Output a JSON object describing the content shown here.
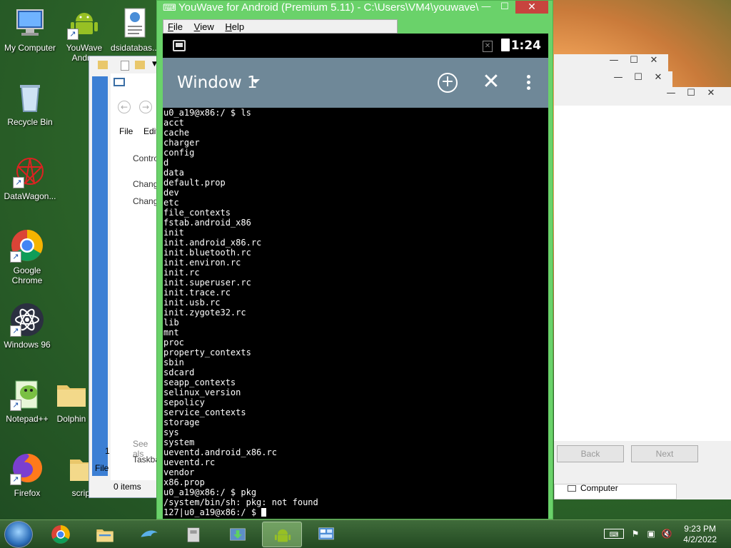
{
  "desktop": {
    "icons": [
      {
        "label": "My Computer"
      },
      {
        "label": "YouWave Andr..."
      },
      {
        "label": "dsidatabas..."
      },
      {
        "label": "Recycle Bin"
      },
      {
        "label": "DataWagon..."
      },
      {
        "label": "Google Chrome"
      },
      {
        "label": "Windows 96"
      },
      {
        "label": "Notepad++"
      },
      {
        "label": "Dolphin"
      },
      {
        "label": "Firefox"
      },
      {
        "label": "scripts"
      }
    ]
  },
  "explorer": {
    "menu_file": "File",
    "menu_edit": "Edit",
    "control_label": "Contro",
    "link1": "Chang",
    "link2": "Chang",
    "see_also": "See als",
    "taskbar_link": "Taskba",
    "num": "1",
    "file_label": "File",
    "items_count": "0 items"
  },
  "wizard": {
    "back_label": "Back",
    "next_label": "Next",
    "computer_label": "Computer"
  },
  "youwave": {
    "title": "YouWave for Android (Premium 5.11) - C:\\Users\\VM4\\youwave\\",
    "menu": [
      {
        "label": "File",
        "key": "F",
        "rest": "ile"
      },
      {
        "label": "View",
        "key": "V",
        "rest": "iew"
      },
      {
        "label": "Help",
        "key": "H",
        "rest": "elp"
      }
    ]
  },
  "android": {
    "status_time": "1:24",
    "action_title": "Window 1",
    "terminal_lines": [
      "u0_a19@x86:/ $ ls",
      "acct",
      "cache",
      "charger",
      "config",
      "d",
      "data",
      "default.prop",
      "dev",
      "etc",
      "file_contexts",
      "fstab.android_x86",
      "init",
      "init.android_x86.rc",
      "init.bluetooth.rc",
      "init.environ.rc",
      "init.rc",
      "init.superuser.rc",
      "init.trace.rc",
      "init.usb.rc",
      "init.zygote32.rc",
      "lib",
      "mnt",
      "proc",
      "property_contexts",
      "sbin",
      "sdcard",
      "seapp_contexts",
      "selinux_version",
      "sepolicy",
      "service_contexts",
      "storage",
      "sys",
      "system",
      "ueventd.android_x86.rc",
      "ueventd.rc",
      "vendor",
      "x86.prop",
      "u0_a19@x86:/ $ pkg",
      "/system/bin/sh: pkg: not found"
    ],
    "prompt": "127|u0_a19@x86:/ $ "
  },
  "taskbar": {
    "time": "9:23 PM",
    "date": "4/2/2022"
  },
  "colors": {
    "youwave_frame": "#6ad26a",
    "action_bar": "#6f8898",
    "close_red": "#c7443e"
  }
}
